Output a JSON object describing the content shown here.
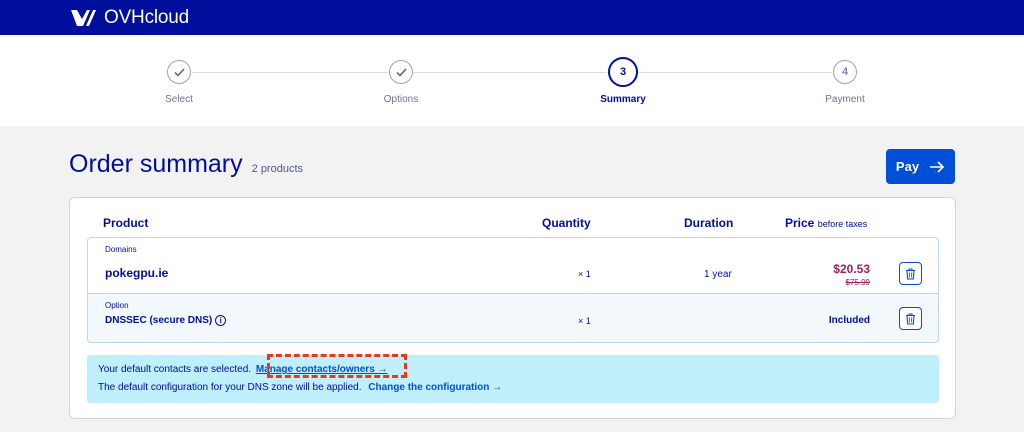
{
  "brand": {
    "name": "OVHcloud"
  },
  "colors": {
    "brand": "#000e9c",
    "accent": "#0050d7",
    "price": "#a1205a",
    "notice_bg": "#bfeffb",
    "highlight": "#e8391d"
  },
  "stepper": {
    "steps": [
      {
        "label": "Select",
        "number": "",
        "status": "done"
      },
      {
        "label": "Options",
        "number": "",
        "status": "done"
      },
      {
        "label": "Summary",
        "number": "3",
        "status": "active"
      },
      {
        "label": "Payment",
        "number": "4",
        "status": "pending"
      }
    ]
  },
  "summary": {
    "title": "Order summary",
    "count": "2 products",
    "pay_label": "Pay"
  },
  "table": {
    "headers": {
      "product": "Product",
      "quantity": "Quantity",
      "duration": "Duration",
      "price": "Price",
      "price_note": "before taxes"
    },
    "rows": [
      {
        "category": "Domains",
        "name": "pokegpu.ie",
        "quantity": "× 1",
        "duration": "1 year",
        "price": "$20.53",
        "old_price": "$75.99"
      },
      {
        "category": "Option",
        "name": "DNSSEC (secure DNS)",
        "quantity": "× 1",
        "duration": "",
        "price": "Included"
      }
    ]
  },
  "notice": {
    "line1": "Your default contacts are selected.",
    "link1": "Manage contacts/owners →",
    "line2": "The default configuration for your DNS zone will be applied.",
    "link2": "Change the configuration →"
  }
}
